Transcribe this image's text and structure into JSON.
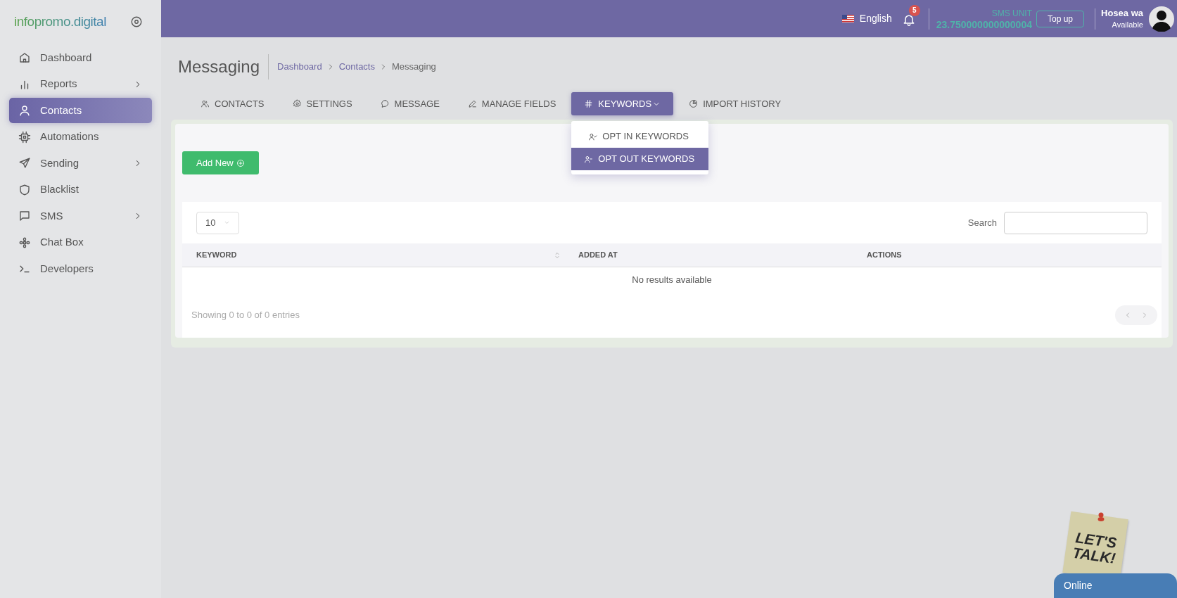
{
  "brand": {
    "logo": "infopromo.digital"
  },
  "sidebar": {
    "items": [
      {
        "label": "Dashboard",
        "selected": false,
        "has_submenu": false
      },
      {
        "label": "Reports",
        "selected": false,
        "has_submenu": true
      },
      {
        "label": "Contacts",
        "selected": true,
        "has_submenu": false
      },
      {
        "label": "Automations",
        "selected": false,
        "has_submenu": false
      },
      {
        "label": "Sending",
        "selected": false,
        "has_submenu": true
      },
      {
        "label": "Blacklist",
        "selected": false,
        "has_submenu": false
      },
      {
        "label": "SMS",
        "selected": false,
        "has_submenu": true
      },
      {
        "label": "Chat Box",
        "selected": false,
        "has_submenu": false
      },
      {
        "label": "Developers",
        "selected": false,
        "has_submenu": false
      }
    ]
  },
  "header": {
    "language": "English",
    "notifications_count": "5",
    "sms_unit_label": "SMS UNIT",
    "sms_unit_value": "23.750000000000004",
    "top_up": "Top up",
    "user_name": "Hosea wa",
    "user_status": "Available"
  },
  "page": {
    "title": "Messaging",
    "breadcrumbs": [
      {
        "label": "Dashboard",
        "link": true
      },
      {
        "label": "Contacts",
        "link": true
      },
      {
        "label": "Messaging",
        "link": false
      }
    ]
  },
  "tabs": [
    {
      "label": "CONTACTS",
      "selected": false
    },
    {
      "label": "SETTINGS",
      "selected": false
    },
    {
      "label": "MESSAGE",
      "selected": false
    },
    {
      "label": "MANAGE FIELDS",
      "selected": false
    },
    {
      "label": "KEYWORDS",
      "selected": true,
      "expanded": true,
      "menu": [
        {
          "label": "OPT IN KEYWORDS",
          "selected": false
        },
        {
          "label": "OPT OUT KEYWORDS",
          "selected": true
        }
      ]
    },
    {
      "label": "IMPORT HISTORY",
      "selected": false
    }
  ],
  "add_button": "Add New",
  "table": {
    "page_length": "10",
    "search_label": "Search",
    "columns": [
      {
        "label": "KEYWORD",
        "sortable": true
      },
      {
        "label": "ADDED AT",
        "sortable": false
      },
      {
        "label": "ACTIONS",
        "sortable": false
      }
    ],
    "empty_message": "No results available",
    "info": "Showing 0 to 0 of 0 entries"
  },
  "chat_widget": {
    "note_lines": [
      "LET'S",
      "TALK!"
    ],
    "status": "Online"
  }
}
